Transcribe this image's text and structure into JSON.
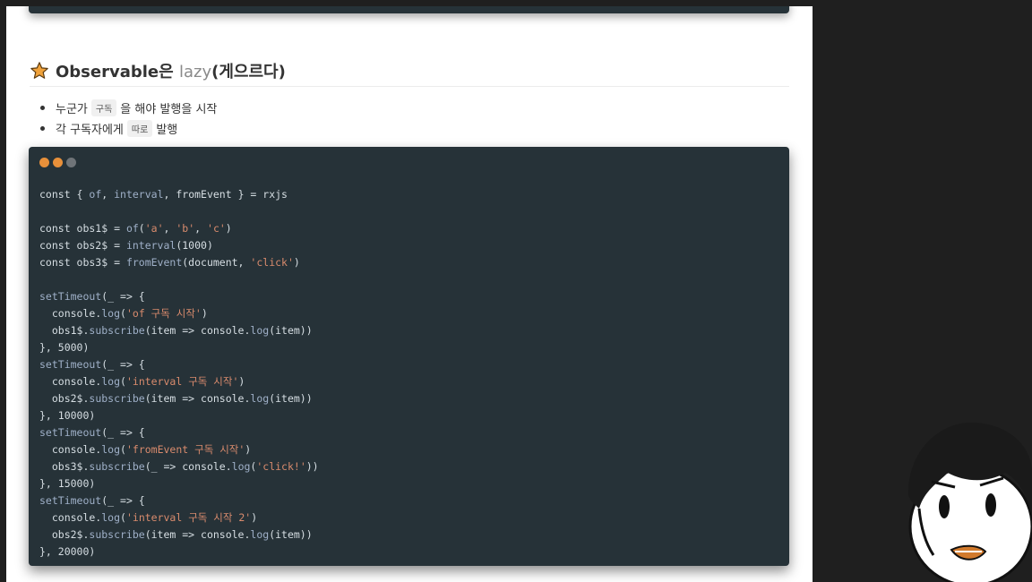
{
  "section": {
    "title_bold": "Observable은 ",
    "title_muted": "lazy",
    "title_rest": "(게으르다)"
  },
  "bullets": [
    {
      "before": "누군가 ",
      "chip": "구독",
      "after": " 을 해야 발행을 시작"
    },
    {
      "before": "각 구독자에게 ",
      "chip": "따로",
      "after": " 발행"
    }
  ],
  "code_window": {
    "dot_colors": [
      "#e8903a",
      "#e8903a",
      "#6f7478"
    ]
  },
  "code_lines": [
    [
      [
        "t",
        "const { "
      ],
      [
        "f",
        "of"
      ],
      [
        "t",
        ", "
      ],
      [
        "f",
        "interval"
      ],
      [
        "t",
        ", fromEvent } = rxjs"
      ]
    ],
    [],
    [
      [
        "t",
        "const obs1$ = "
      ],
      [
        "f",
        "of"
      ],
      [
        "t",
        "("
      ],
      [
        "s",
        "'a'"
      ],
      [
        "t",
        ", "
      ],
      [
        "s",
        "'b'"
      ],
      [
        "t",
        ", "
      ],
      [
        "s",
        "'c'"
      ],
      [
        "t",
        ")"
      ]
    ],
    [
      [
        "t",
        "const obs2$ = "
      ],
      [
        "f",
        "interval"
      ],
      [
        "t",
        "(1000)"
      ]
    ],
    [
      [
        "t",
        "const obs3$ = "
      ],
      [
        "f",
        "fromEvent"
      ],
      [
        "t",
        "(document, "
      ],
      [
        "s",
        "'click'"
      ],
      [
        "t",
        ")"
      ]
    ],
    [],
    [
      [
        "f",
        "setTimeout"
      ],
      [
        "t",
        "(_ => {"
      ]
    ],
    [
      [
        "t",
        "  console."
      ],
      [
        "f",
        "log"
      ],
      [
        "t",
        "("
      ],
      [
        "s",
        "'of 구독 시작'"
      ],
      [
        "t",
        ")"
      ]
    ],
    [
      [
        "t",
        "  obs1$."
      ],
      [
        "f",
        "subscribe"
      ],
      [
        "t",
        "(item => console."
      ],
      [
        "f",
        "log"
      ],
      [
        "t",
        "(item))"
      ]
    ],
    [
      [
        "t",
        "}, 5000)"
      ]
    ],
    [
      [
        "f",
        "setTimeout"
      ],
      [
        "t",
        "(_ => {"
      ]
    ],
    [
      [
        "t",
        "  console."
      ],
      [
        "f",
        "log"
      ],
      [
        "t",
        "("
      ],
      [
        "s",
        "'interval 구독 시작'"
      ],
      [
        "t",
        ")"
      ]
    ],
    [
      [
        "t",
        "  obs2$."
      ],
      [
        "f",
        "subscribe"
      ],
      [
        "t",
        "(item => console."
      ],
      [
        "f",
        "log"
      ],
      [
        "t",
        "(item))"
      ]
    ],
    [
      [
        "t",
        "}, 10000)"
      ]
    ],
    [
      [
        "f",
        "setTimeout"
      ],
      [
        "t",
        "(_ => {"
      ]
    ],
    [
      [
        "t",
        "  console."
      ],
      [
        "f",
        "log"
      ],
      [
        "t",
        "("
      ],
      [
        "s",
        "'fromEvent 구독 시작'"
      ],
      [
        "t",
        ")"
      ]
    ],
    [
      [
        "t",
        "  obs3$."
      ],
      [
        "f",
        "subscribe"
      ],
      [
        "t",
        "(_ => console."
      ],
      [
        "f",
        "log"
      ],
      [
        "t",
        "("
      ],
      [
        "s",
        "'click!'"
      ],
      [
        "t",
        "))"
      ]
    ],
    [
      [
        "t",
        "}, 15000)"
      ]
    ],
    [
      [
        "f",
        "setTimeout"
      ],
      [
        "t",
        "(_ => {"
      ]
    ],
    [
      [
        "t",
        "  console."
      ],
      [
        "f",
        "log"
      ],
      [
        "t",
        "("
      ],
      [
        "s",
        "'interval 구독 시작 2'"
      ],
      [
        "t",
        ")"
      ]
    ],
    [
      [
        "t",
        "  obs2$."
      ],
      [
        "f",
        "subscribe"
      ],
      [
        "t",
        "(item => console."
      ],
      [
        "f",
        "log"
      ],
      [
        "t",
        "(item))"
      ]
    ],
    [
      [
        "t",
        "}, 20000)"
      ]
    ]
  ],
  "colors": {
    "code_bg": "#263238",
    "code_text": "#d6dee3",
    "code_fn": "#9fb0c8",
    "code_string": "#d98b6d",
    "star": "#f0a23b"
  }
}
